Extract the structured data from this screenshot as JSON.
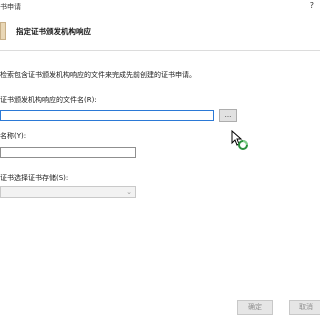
{
  "window": {
    "title": "书申请",
    "help": "?"
  },
  "header": {
    "title": "指定证书颁发机构响应"
  },
  "main": {
    "description": "检索包含证书颁发机构响应的文件来完成先前创建的证书申请。",
    "file_label": "证书颁发机构响应的文件名(R):",
    "file_value": "",
    "browse_label": "...",
    "name_label": "名称(Y):",
    "name_value": "",
    "store_label": "证书选择证书存储(S):",
    "store_value": ""
  },
  "footer": {
    "ok_label": "确定",
    "cancel_label": "取消"
  }
}
